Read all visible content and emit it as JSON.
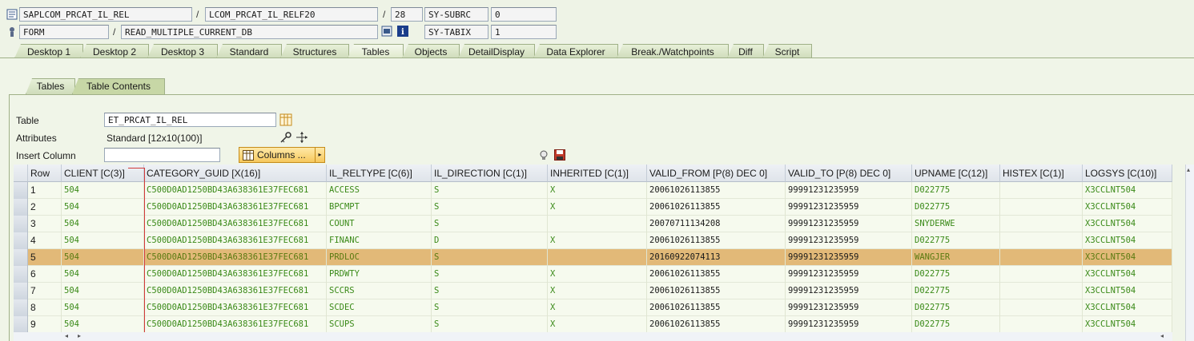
{
  "header": {
    "program": "SAPLCOM_PRCAT_IL_REL",
    "include": "LCOM_PRCAT_IL_RELF20",
    "line": "28",
    "sysvar1_name": "SY-SUBRC",
    "sysvar1_value": "0",
    "event_type": "FORM",
    "event_name": "READ_MULTIPLE_CURRENT_DB",
    "sysvar2_name": "SY-TABIX",
    "sysvar2_value": "1",
    "sep": "/"
  },
  "tabs": [
    "Desktop 1",
    "Desktop 2",
    "Desktop 3",
    "Standard",
    "Structures",
    "Tables",
    "Objects",
    "DetailDisplay",
    "Data Explorer",
    "Break./Watchpoints",
    "Diff",
    "Script"
  ],
  "active_tab": "Tables",
  "subtabs": [
    "Tables",
    "Table Contents"
  ],
  "active_subtab": "Table Contents",
  "form": {
    "table_label": "Table",
    "table_value": "ET_PRCAT_IL_REL",
    "attributes_label": "Attributes",
    "attributes_value": "Standard [12x10(100)]",
    "insert_label": "Insert Column",
    "insert_value": "",
    "columns_button": "Columns ..."
  },
  "grid": {
    "columns": [
      "Row",
      "CLIENT [C(3)]",
      "CATEGORY_GUID [X(16)]",
      "IL_RELTYPE [C(6)]",
      "IL_DIRECTION [C(1)]",
      "INHERITED [C(1)]",
      "VALID_FROM [P(8) DEC 0]",
      "VALID_TO [P(8) DEC 0]",
      "UPNAME [C(12)]",
      "HISTEX [C(1)]",
      "LOGSYS [C(10)]"
    ],
    "rows": [
      [
        "1",
        "504",
        "C500D0AD1250BD43A638361E37FEC681",
        "ACCESS",
        "S",
        "X",
        "20061026113855",
        "99991231235959",
        "D022775",
        "",
        "X3CCLNT504"
      ],
      [
        "2",
        "504",
        "C500D0AD1250BD43A638361E37FEC681",
        "BPCMPT",
        "S",
        "X",
        "20061026113855",
        "99991231235959",
        "D022775",
        "",
        "X3CCLNT504"
      ],
      [
        "3",
        "504",
        "C500D0AD1250BD43A638361E37FEC681",
        "COUNT",
        "S",
        "",
        "20070711134208",
        "99991231235959",
        "SNYDERWE",
        "",
        "X3CCLNT504"
      ],
      [
        "4",
        "504",
        "C500D0AD1250BD43A638361E37FEC681",
        "FINANC",
        "D",
        "X",
        "20061026113855",
        "99991231235959",
        "D022775",
        "",
        "X3CCLNT504"
      ],
      [
        "5",
        "504",
        "C500D0AD1250BD43A638361E37FEC681",
        "PRDLOC",
        "S",
        "",
        "20160922074113",
        "99991231235959",
        "WANGJER",
        "",
        "X3CCLNT504"
      ],
      [
        "6",
        "504",
        "C500D0AD1250BD43A638361E37FEC681",
        "PRDWTY",
        "S",
        "X",
        "20061026113855",
        "99991231235959",
        "D022775",
        "",
        "X3CCLNT504"
      ],
      [
        "7",
        "504",
        "C500D0AD1250BD43A638361E37FEC681",
        "SCCRS",
        "S",
        "X",
        "20061026113855",
        "99991231235959",
        "D022775",
        "",
        "X3CCLNT504"
      ],
      [
        "8",
        "504",
        "C500D0AD1250BD43A638361E37FEC681",
        "SCDEC",
        "S",
        "X",
        "20061026113855",
        "99991231235959",
        "D022775",
        "",
        "X3CCLNT504"
      ],
      [
        "9",
        "504",
        "C500D0AD1250BD43A638361E37FEC681",
        "SCUPS",
        "S",
        "X",
        "20061026113855",
        "99991231235959",
        "D022775",
        "",
        "X3CCLNT504"
      ]
    ],
    "selected_row": "5"
  }
}
